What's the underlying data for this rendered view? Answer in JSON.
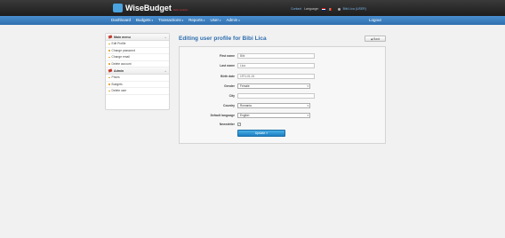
{
  "header": {
    "logo_text": "WiseBudget",
    "logo_tagline": "beta version",
    "contact_label": "Contact",
    "language_label": "Language:",
    "user_label": "Bibi Lica (USER)"
  },
  "nav": {
    "items": [
      {
        "label": "Dashboard",
        "caret": ""
      },
      {
        "label": "Budgets",
        "caret": "▾"
      },
      {
        "label": "Transactions",
        "caret": "▾"
      },
      {
        "label": "Reports",
        "caret": "▾"
      },
      {
        "label": "User",
        "caret": "▾"
      },
      {
        "label": "Admin",
        "caret": "▾"
      }
    ],
    "logout_label": "Logout"
  },
  "sidebar": {
    "main_menu_title": "Main menu",
    "main_items": [
      "Edit Profile",
      "Change password",
      "Change email",
      "Delete account"
    ],
    "admin_title": "Admin",
    "admin_items": [
      "Prices",
      "Budgets",
      "Delete user"
    ],
    "toggle_symbol": "«"
  },
  "page": {
    "title": "Editing user profile for Bibi Lica",
    "back_label": "Back"
  },
  "form": {
    "first_name": {
      "label": "First name",
      "value": "Bibi"
    },
    "last_name": {
      "label": "Last name",
      "value": "Lica"
    },
    "birth_date": {
      "label": "Birth date",
      "value": "1971-01-01"
    },
    "gender": {
      "label": "Gender",
      "value": "Female"
    },
    "city": {
      "label": "City",
      "value": ""
    },
    "country": {
      "label": "Country",
      "value": "Romania"
    },
    "default_language": {
      "label": "Default language",
      "value": "English"
    },
    "newsletter": {
      "label": "Newsletter",
      "checked": true,
      "mark": "✓"
    },
    "update_label": "Update »"
  },
  "colors": {
    "topbar": "#262626",
    "navbar": "#3a7dbf",
    "title": "#2e6eaf",
    "button": "#2a8fd4"
  }
}
